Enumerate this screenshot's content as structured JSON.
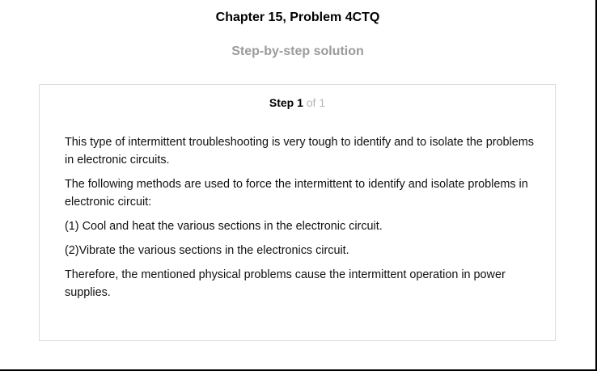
{
  "header": {
    "title": "Chapter 15, Problem 4CTQ",
    "subtitle": "Step-by-step solution"
  },
  "step": {
    "label": "Step 1",
    "of_text": "of 1"
  },
  "paragraphs": [
    "This type of intermittent troubleshooting is very tough to identify and to isolate the problems in electronic circuits.",
    "The following methods are used to force the intermittent to identify and isolate problems in electronic circuit:",
    "(1) Cool and heat the various sections in the electronic circuit.",
    "(2)Vibrate the various sections in the electronics circuit.",
    "Therefore, the mentioned physical problems cause the intermittent operation in power supplies."
  ]
}
